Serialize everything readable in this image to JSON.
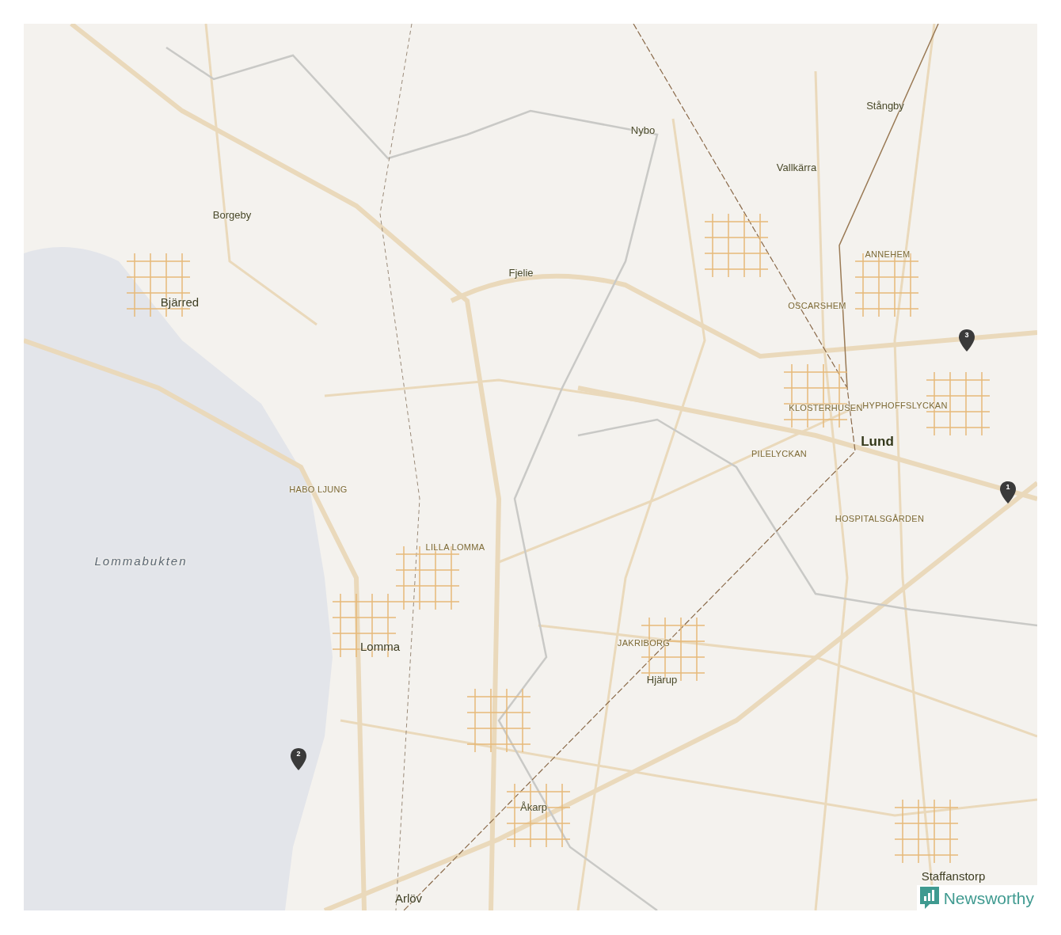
{
  "map": {
    "labels": [
      {
        "text": "Stångby",
        "kind": "place"
      },
      {
        "text": "Nybo",
        "kind": "place"
      },
      {
        "text": "Vallkärra",
        "kind": "place"
      },
      {
        "text": "Borgeby",
        "kind": "place"
      },
      {
        "text": "ANNEHEM",
        "kind": "district"
      },
      {
        "text": "Fjelie",
        "kind": "place"
      },
      {
        "text": "Bjärred",
        "kind": "town"
      },
      {
        "text": "OSCARSHEM",
        "kind": "district"
      },
      {
        "text": "KLOSTERHUSEN",
        "kind": "district"
      },
      {
        "text": "HYPHOFFSLYCKAN",
        "kind": "district"
      },
      {
        "text": "Lund",
        "kind": "city"
      },
      {
        "text": "PILELYCKAN",
        "kind": "district"
      },
      {
        "text": "HABO LJUNG",
        "kind": "district"
      },
      {
        "text": "HOSPITALSGÅRDEN",
        "kind": "district"
      },
      {
        "text": "LILLA LOMMA",
        "kind": "district"
      },
      {
        "text": "Lommabukten",
        "kind": "water"
      },
      {
        "text": "JAKRIBORG",
        "kind": "district"
      },
      {
        "text": "Lomma",
        "kind": "town"
      },
      {
        "text": "Hjärup",
        "kind": "place"
      },
      {
        "text": "Åkarp",
        "kind": "place"
      },
      {
        "text": "Staffanstorp",
        "kind": "town"
      },
      {
        "text": "Arlöv",
        "kind": "town"
      }
    ],
    "markers": [
      {
        "label": "1"
      },
      {
        "label": "2"
      },
      {
        "label": "3"
      }
    ],
    "logo": {
      "text": "Newsworthy"
    }
  }
}
